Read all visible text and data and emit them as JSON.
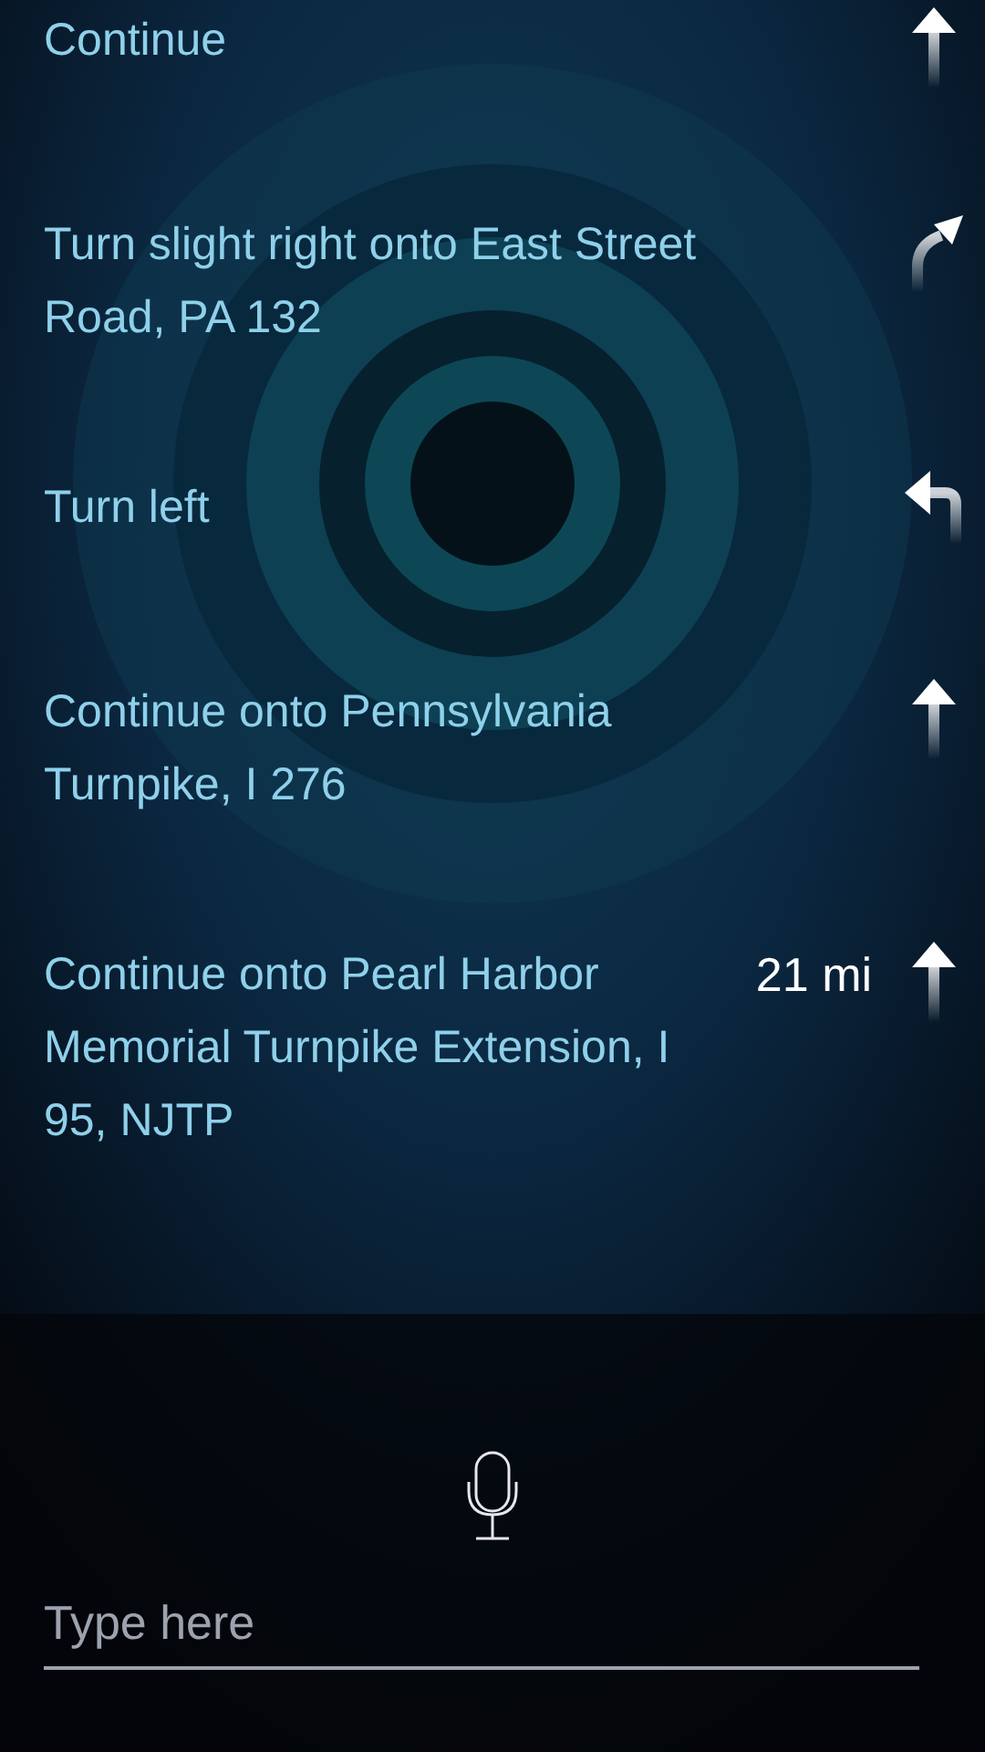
{
  "steps": [
    {
      "instruction": "Continue",
      "kind": "straight"
    },
    {
      "instruction": "Turn slight right onto East Street Road, PA 132",
      "kind": "slight_right"
    },
    {
      "instruction": "Turn left",
      "kind": "left"
    },
    {
      "instruction": "Continue onto Pennsylvania Turnpike, I 276",
      "kind": "straight"
    },
    {
      "instruction": "Continue onto Pearl Harbor Memorial Turnpike Extension, I 95, NJTP",
      "distance": "21 mi",
      "kind": "straight"
    }
  ],
  "input": {
    "placeholder": "Type here"
  }
}
